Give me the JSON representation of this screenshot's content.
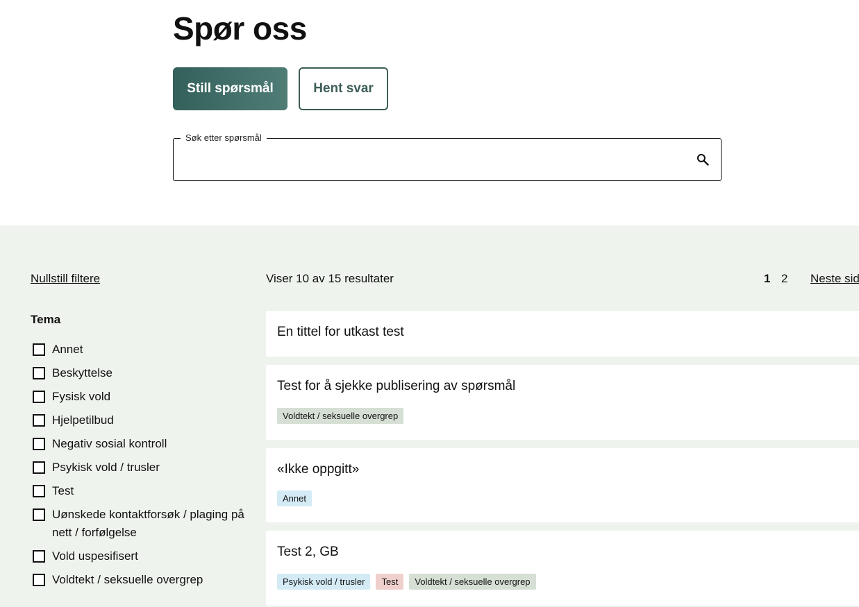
{
  "header": {
    "title": "Spør oss",
    "ask_button": "Still spørsmål",
    "answer_button": "Hent svar"
  },
  "search": {
    "legend": "Søk etter spørsmål",
    "value": "",
    "icon": "search-icon"
  },
  "filters": {
    "reset_label": "Nullstill filtere",
    "heading": "Tema",
    "items": [
      {
        "label": "Annet",
        "checked": false
      },
      {
        "label": "Beskyttelse",
        "checked": false
      },
      {
        "label": "Fysisk vold",
        "checked": false
      },
      {
        "label": "Hjelpetilbud",
        "checked": false
      },
      {
        "label": "Negativ sosial kontroll",
        "checked": false
      },
      {
        "label": "Psykisk vold / trusler",
        "checked": false
      },
      {
        "label": "Test",
        "checked": false
      },
      {
        "label": "Uønskede kontaktforsøk / plaging på nett / forfølgelse",
        "checked": false
      },
      {
        "label": "Vold uspesifisert",
        "checked": false
      },
      {
        "label": "Voldtekt / seksuelle overgrep",
        "checked": false
      }
    ]
  },
  "results": {
    "summary": "Viser 10 av 15 resultater",
    "pagination": {
      "current": "1",
      "next_page": "2",
      "next_label": "Neste side"
    },
    "cards": [
      {
        "title": "En tittel for utkast test",
        "tags": []
      },
      {
        "title": "Test for å sjekke publisering av spørsmål",
        "tags": [
          {
            "label": "Voldtekt / seksuelle overgrep",
            "color": "#d5dfd4"
          }
        ]
      },
      {
        "title": "«Ikke oppgitt»",
        "tags": [
          {
            "label": "Annet",
            "color": "#d4ebf6"
          }
        ]
      },
      {
        "title": "Test 2, GB",
        "tags": [
          {
            "label": "Psykisk vold / trusler",
            "color": "#d4ebf6"
          },
          {
            "label": "Test",
            "color": "#f0d0cc"
          },
          {
            "label": "Voldtekt / seksuelle overgrep",
            "color": "#d5dfd4"
          }
        ]
      }
    ]
  },
  "colors": {
    "primary_button": "#3d6b65",
    "page_background_lower": "#eff3ee"
  }
}
